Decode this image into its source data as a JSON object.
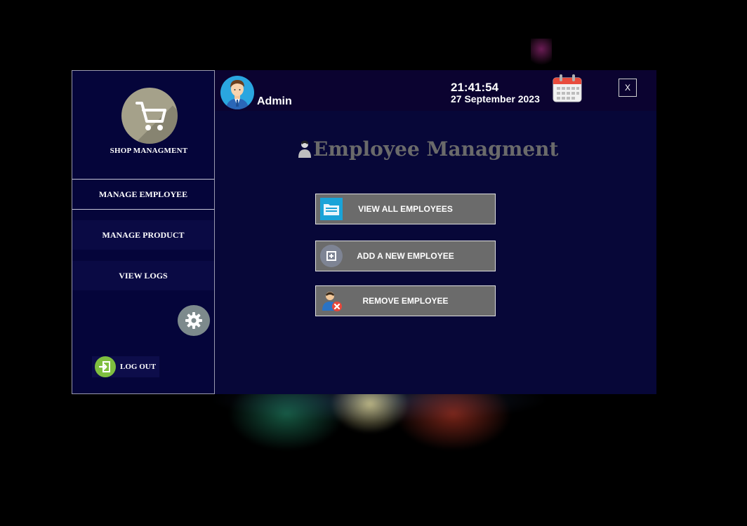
{
  "sidebar": {
    "logo_title": "SHOP MANAGMENT",
    "items": [
      {
        "label": "MANAGE EMPLOYEE",
        "active": true
      },
      {
        "label": "MANAGE PRODUCT",
        "active": false
      },
      {
        "label": "VIEW LOGS",
        "active": false
      }
    ],
    "logout_label": "LOG OUT",
    "icons": [
      "shopping-cart-icon",
      "gear-icon",
      "logout-icon"
    ]
  },
  "header": {
    "user_name": "Admin",
    "time": "21:41:54",
    "date": "27 September 2023",
    "close_label": "X"
  },
  "main": {
    "title": "Employee Managment",
    "buttons": [
      {
        "label": "VIEW ALL EMPLOYEES",
        "icon": "folder-icon"
      },
      {
        "label": "ADD A NEW EMPLOYEE",
        "icon": "add-square-icon"
      },
      {
        "label": "REMOVE EMPLOYEE",
        "icon": "remove-user-icon"
      }
    ]
  },
  "colors": {
    "sidebar_bg": "#05053a",
    "main_bg": "#070738",
    "topbar_bg": "#0b0330",
    "button_bg": "#6b6b6b",
    "title_gray": "#6a6a6a"
  }
}
